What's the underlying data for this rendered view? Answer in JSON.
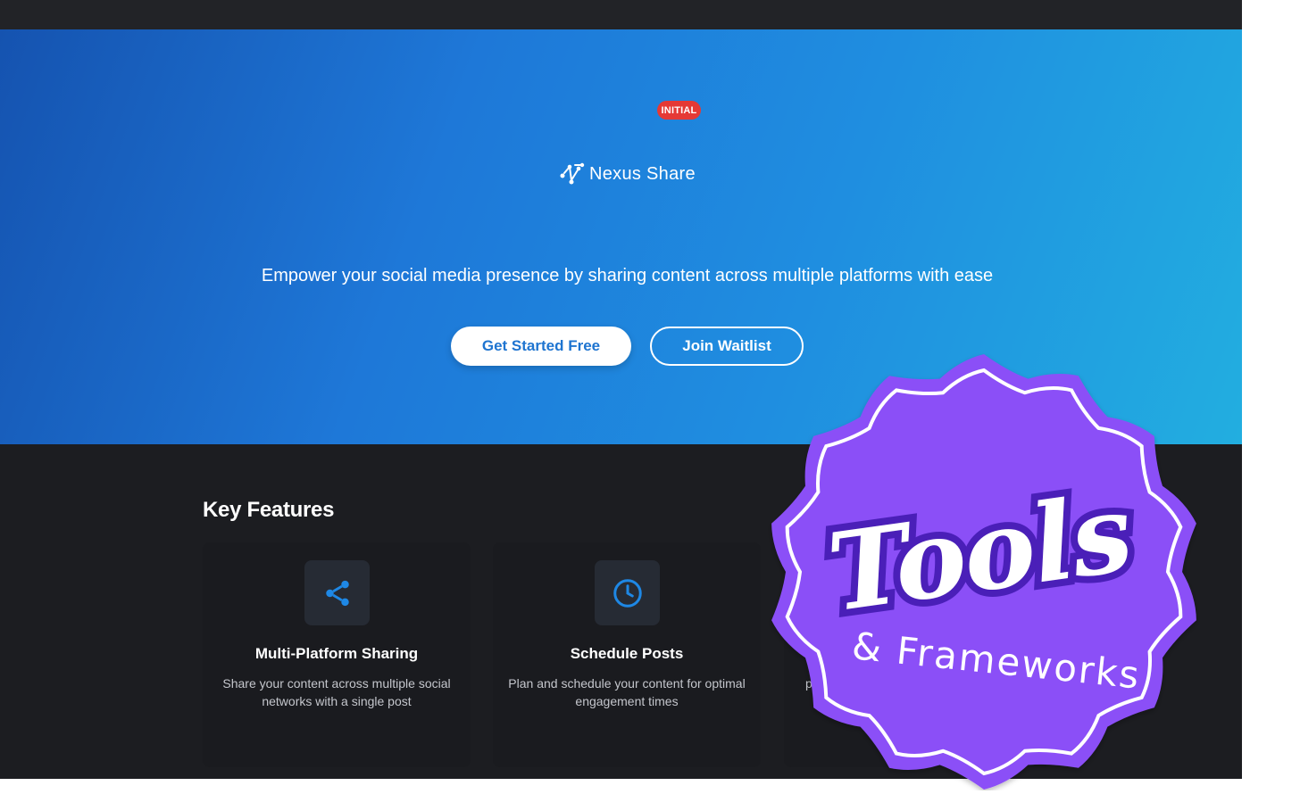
{
  "badge": {
    "label": "INITIAL"
  },
  "brand": {
    "name": "Nexus Share",
    "icon": "nexus-logo-icon"
  },
  "hero": {
    "tagline": "Empower your social media presence by sharing content across multiple platforms with ease",
    "primary_button": "Get Started Free",
    "secondary_button": "Join Waitlist"
  },
  "features": {
    "title": "Key Features",
    "items": [
      {
        "title": "Multi-Platform Sharing",
        "description": "Share your content across multiple social networks with a single post",
        "icon": "share-icon"
      },
      {
        "title": "Schedule Posts",
        "description": "Plan and schedule your content for optimal engagement times",
        "icon": "clock-icon"
      },
      {
        "title": "",
        "description": "pla",
        "icon": "analytics-icon"
      }
    ]
  },
  "sticker": {
    "line1": "Tools",
    "line2": "& Frameworks"
  },
  "colors": {
    "accent": "#1e88e5",
    "badge": "#e53935",
    "sticker": "#8b4ff7",
    "background": "#1c1d21"
  }
}
